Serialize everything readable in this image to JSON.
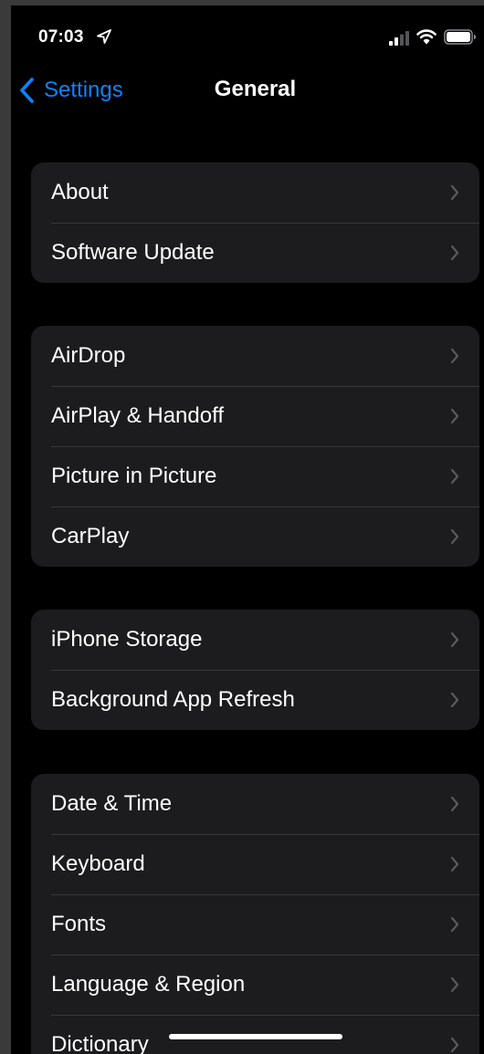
{
  "status_bar": {
    "time": "07:03",
    "icons": [
      "location-arrow-icon",
      "cellular-signal-icon",
      "wifi-icon",
      "battery-icon"
    ]
  },
  "nav": {
    "back_label": "Settings",
    "title": "General"
  },
  "colors": {
    "accent": "#0a84ff",
    "background": "#000000",
    "group_background": "#1c1c1e",
    "separator": "#38383a",
    "chevron": "#5a5a5e"
  },
  "groups": [
    {
      "items": [
        {
          "label": "About"
        },
        {
          "label": "Software Update"
        }
      ]
    },
    {
      "items": [
        {
          "label": "AirDrop"
        },
        {
          "label": "AirPlay & Handoff"
        },
        {
          "label": "Picture in Picture"
        },
        {
          "label": "CarPlay"
        }
      ]
    },
    {
      "items": [
        {
          "label": "iPhone Storage"
        },
        {
          "label": "Background App Refresh"
        }
      ]
    },
    {
      "items": [
        {
          "label": "Date & Time"
        },
        {
          "label": "Keyboard"
        },
        {
          "label": "Fonts"
        },
        {
          "label": "Language & Region"
        },
        {
          "label": "Dictionary"
        }
      ]
    }
  ]
}
